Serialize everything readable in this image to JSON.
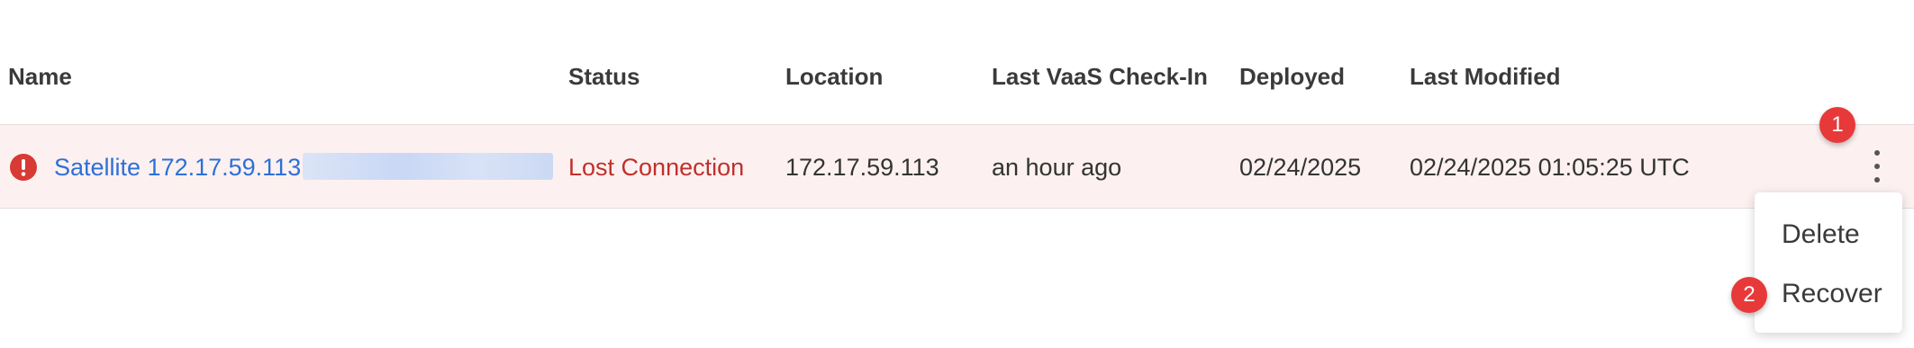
{
  "table": {
    "columns": [
      "Name",
      "Status",
      "Location",
      "Last VaaS Check-In",
      "Deployed",
      "Last Modified"
    ],
    "rows": [
      {
        "name": "Satellite 172.17.59.113",
        "status": "Lost Connection",
        "location": "172.17.59.113",
        "last_checkin": "an hour ago",
        "deployed": "02/24/2025",
        "last_modified": "02/24/2025 01:05:25 UTC",
        "status_icon": "error-icon"
      }
    ]
  },
  "row_menu": {
    "items": [
      "Delete",
      "Recover"
    ]
  },
  "markers": [
    "1",
    "2"
  ],
  "colors": {
    "row_background": "#fcf1f0",
    "link": "#2e6fd8",
    "error": "#c0302b",
    "marker": "#e8393a"
  }
}
